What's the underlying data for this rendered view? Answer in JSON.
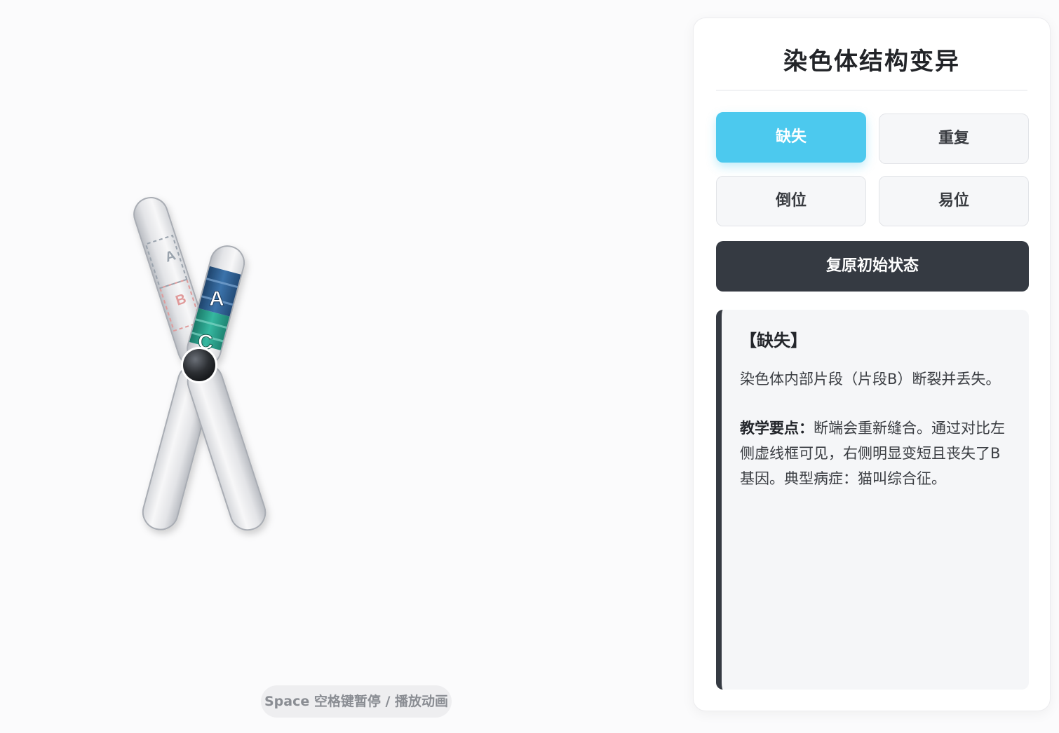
{
  "chromosome": {
    "ghost_labels": [
      "A",
      "B"
    ],
    "gene_labels": [
      "A",
      "C"
    ],
    "colors": {
      "gene_a": "#2f5f91",
      "gene_c": "#2a9f8a",
      "ghost_a": "#9aa3ad",
      "ghost_b": "#e09a9a",
      "centromere": "#2c2f33"
    }
  },
  "hint": {
    "text": "Space 空格键暂停 / 播放动画"
  },
  "panel": {
    "title": "染色体结构变异",
    "buttons": {
      "deletion": "缺失",
      "duplication": "重复",
      "inversion": "倒位",
      "translocation": "易位",
      "active": "deletion"
    },
    "reset_label": "复原初始状态",
    "info": {
      "title": "【缺失】",
      "description": "染色体内部片段（片段B）断裂并丢失。",
      "key_label": "教学要点：",
      "key_text": "断端会重新缝合。通过对比左侧虚线框可见，右侧明显变短且丧失了B基因。典型病症：猫叫综合征。"
    },
    "accent_color": "#4cc9ee"
  }
}
